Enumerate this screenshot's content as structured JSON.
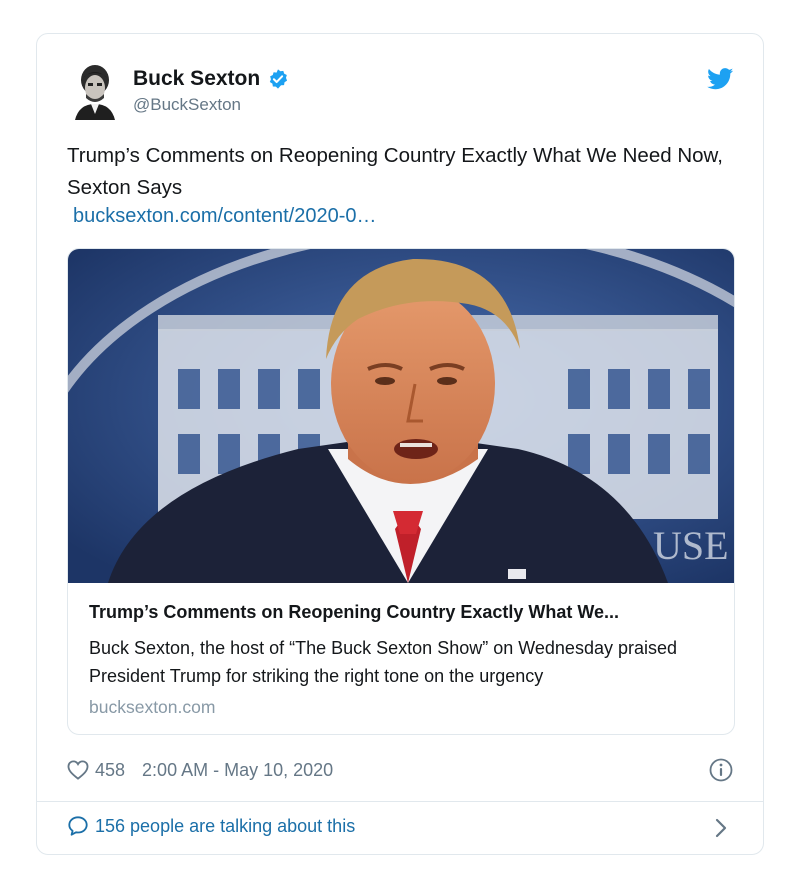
{
  "tweet": {
    "author_name": "Buck Sexton",
    "author_handle": "@BuckSexton",
    "text": "Trump’s Comments on Reopening Country Exactly What We Need Now, Sexton Says",
    "link": "bucksexton.com/content/2020-0…",
    "like_count": "458",
    "timestamp": "2:00 AM - May 10, 2020",
    "talking": "156 people are talking about this"
  },
  "card": {
    "title": "Trump’s Comments on Reopening Country Exactly What We...",
    "description": "Buck Sexton, the host of “The Buck Sexton Show” on Wednesday praised President Trump for striking the right tone on the urgency",
    "domain": "bucksexton.com",
    "image_text": "USE"
  },
  "colors": {
    "accent": "#1da1f2",
    "link": "#1b6fa8",
    "muted": "#657786",
    "border": "#e1e8ed"
  },
  "icons": [
    "verified-badge-icon",
    "twitter-bird-icon",
    "heart-icon",
    "info-icon",
    "speech-bubble-icon",
    "chevron-right-icon"
  ]
}
